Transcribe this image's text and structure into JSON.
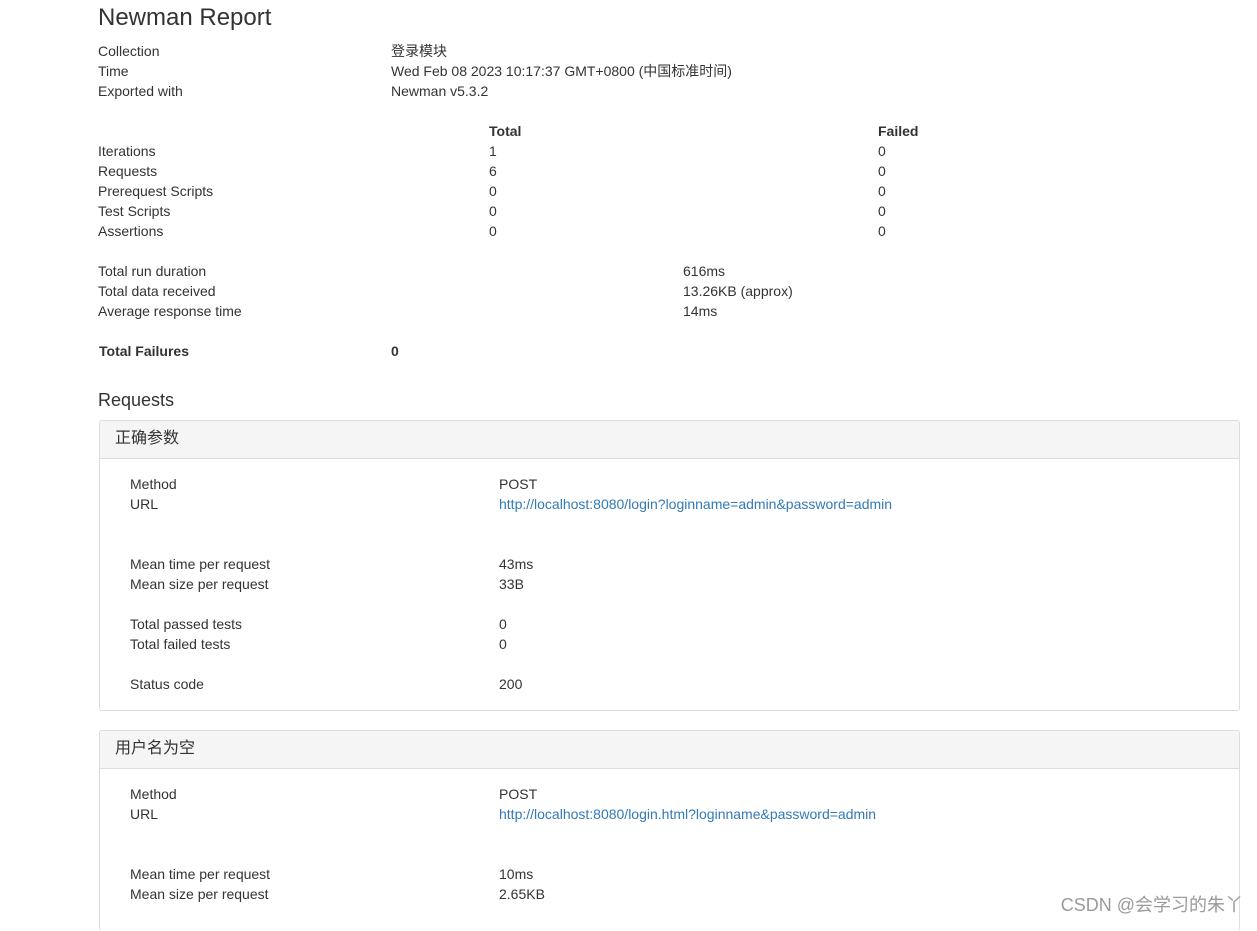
{
  "report_title": "Newman Report",
  "info": {
    "collection_label": "Collection",
    "collection_value": "登录模块",
    "time_label": "Time",
    "time_value": "Wed Feb 08 2023 10:17:37 GMT+0800 (中国标准时间)",
    "exported_label": "Exported with",
    "exported_value": "Newman v5.3.2"
  },
  "summary": {
    "headers": {
      "total": "Total",
      "failed": "Failed"
    },
    "rows": [
      {
        "label": "Iterations",
        "total": "1",
        "failed": "0"
      },
      {
        "label": "Requests",
        "total": "6",
        "failed": "0"
      },
      {
        "label": "Prerequest Scripts",
        "total": "0",
        "failed": "0"
      },
      {
        "label": "Test Scripts",
        "total": "0",
        "failed": "0"
      },
      {
        "label": "Assertions",
        "total": "0",
        "failed": "0"
      }
    ]
  },
  "stats": {
    "duration_label": "Total run duration",
    "duration_value": "616ms",
    "data_label": "Total data received",
    "data_value": "13.26KB (approx)",
    "avg_label": "Average response time",
    "avg_value": "14ms"
  },
  "failures": {
    "label": "Total Failures",
    "value": "0"
  },
  "requests_heading": "Requests",
  "requests": [
    {
      "name": "正确参数",
      "method_label": "Method",
      "method": "POST",
      "url_label": "URL",
      "url": "http://localhost:8080/login?loginname=admin&password=admin",
      "mean_time_label": "Mean time per request",
      "mean_time": "43ms",
      "mean_size_label": "Mean size per request",
      "mean_size": "33B",
      "passed_label": "Total passed tests",
      "passed": "0",
      "failed_label": "Total failed tests",
      "failed": "0",
      "status_label": "Status code",
      "status": "200"
    },
    {
      "name": "用户名为空",
      "method_label": "Method",
      "method": "POST",
      "url_label": "URL",
      "url": "http://localhost:8080/login.html?loginname&password=admin",
      "mean_time_label": "Mean time per request",
      "mean_time": "10ms",
      "mean_size_label": "Mean size per request",
      "mean_size": "2.65KB"
    }
  ],
  "watermark": "CSDN @会学习的朱丫"
}
